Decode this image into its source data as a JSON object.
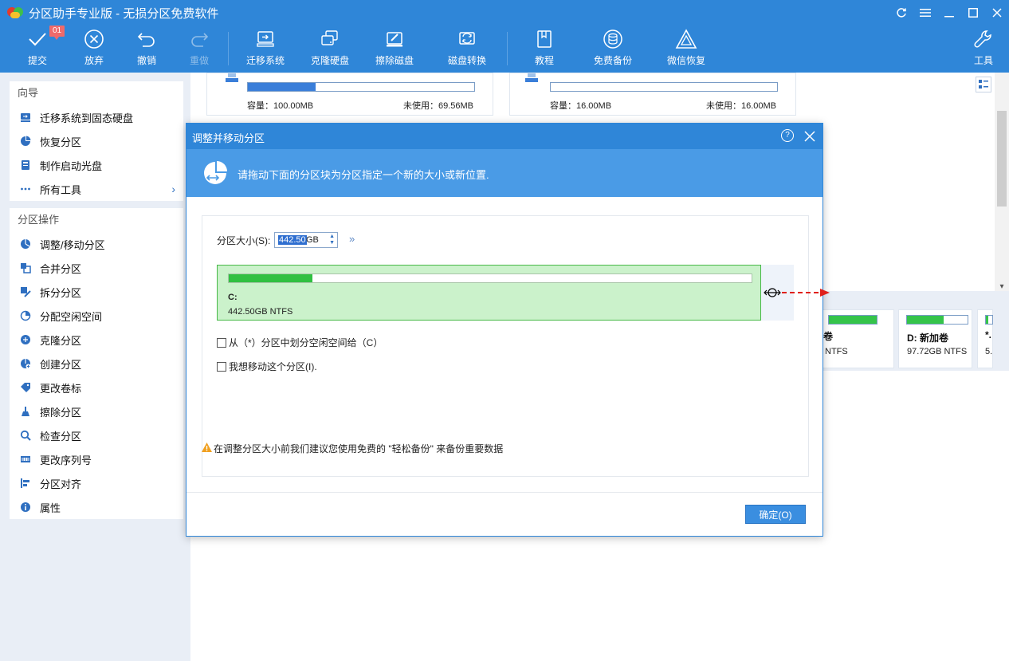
{
  "app": {
    "title": "分区助手专业版 - 无损分区免费软件"
  },
  "toolbar": {
    "badge": "01",
    "items": [
      {
        "label": "提交"
      },
      {
        "label": "放弃"
      },
      {
        "label": "撤销"
      },
      {
        "label": "重做"
      },
      {
        "label": "迁移系统"
      },
      {
        "label": "克隆硬盘"
      },
      {
        "label": "擦除磁盘"
      },
      {
        "label": "磁盘转换"
      },
      {
        "label": "教程"
      },
      {
        "label": "免费备份"
      },
      {
        "label": "微信恢复"
      },
      {
        "label": "工具"
      }
    ]
  },
  "sidebar": {
    "wizard_title": "向导",
    "wizard_items": [
      {
        "label": "迁移系统到固态硬盘"
      },
      {
        "label": "恢复分区"
      },
      {
        "label": "制作启动光盘"
      },
      {
        "label": "所有工具"
      }
    ],
    "ops_title": "分区操作",
    "ops_items": [
      {
        "label": "调整/移动分区"
      },
      {
        "label": "合并分区"
      },
      {
        "label": "拆分分区"
      },
      {
        "label": "分配空闲空间"
      },
      {
        "label": "克隆分区"
      },
      {
        "label": "创建分区"
      },
      {
        "label": "更改卷标"
      },
      {
        "label": "擦除分区"
      },
      {
        "label": "检查分区"
      },
      {
        "label": "更改序列号"
      },
      {
        "label": "分区对齐"
      },
      {
        "label": "属性"
      }
    ]
  },
  "main": {
    "cards": [
      {
        "capacity": "容量：100.00MB",
        "free": "未使用：69.56MB",
        "used_fraction": 0.3
      },
      {
        "capacity": "容量：16.00MB",
        "free": "未使用：16.00MB",
        "used_fraction": 0.0
      }
    ],
    "disk_partitions": [
      {
        "name": "卷",
        "size": "NTFS"
      },
      {
        "name": "D: 新加卷",
        "size": "97.72GB NTFS"
      },
      {
        "name": "*.",
        "size": "5."
      }
    ]
  },
  "dialog": {
    "title": "调整并移动分区",
    "help": "?",
    "banner_text": "请拖动下面的分区块为分区指定一个新的大小或新位置.",
    "size_label": "分区大小(S):",
    "size_value": "442.50",
    "size_unit": "GB",
    "expand": "»",
    "partition": {
      "name": "C:",
      "size": "442.50GB NTFS",
      "used_fraction": 0.16
    },
    "checkbox1": "从（*）分区中划分空闲空间给（C）",
    "checkbox2": "我想移动这个分区(I).",
    "warning": "在调整分区大小前我们建议您使用免费的 \"轻松备份\" 来备份重要数据",
    "ok_button": "确定(O)"
  }
}
